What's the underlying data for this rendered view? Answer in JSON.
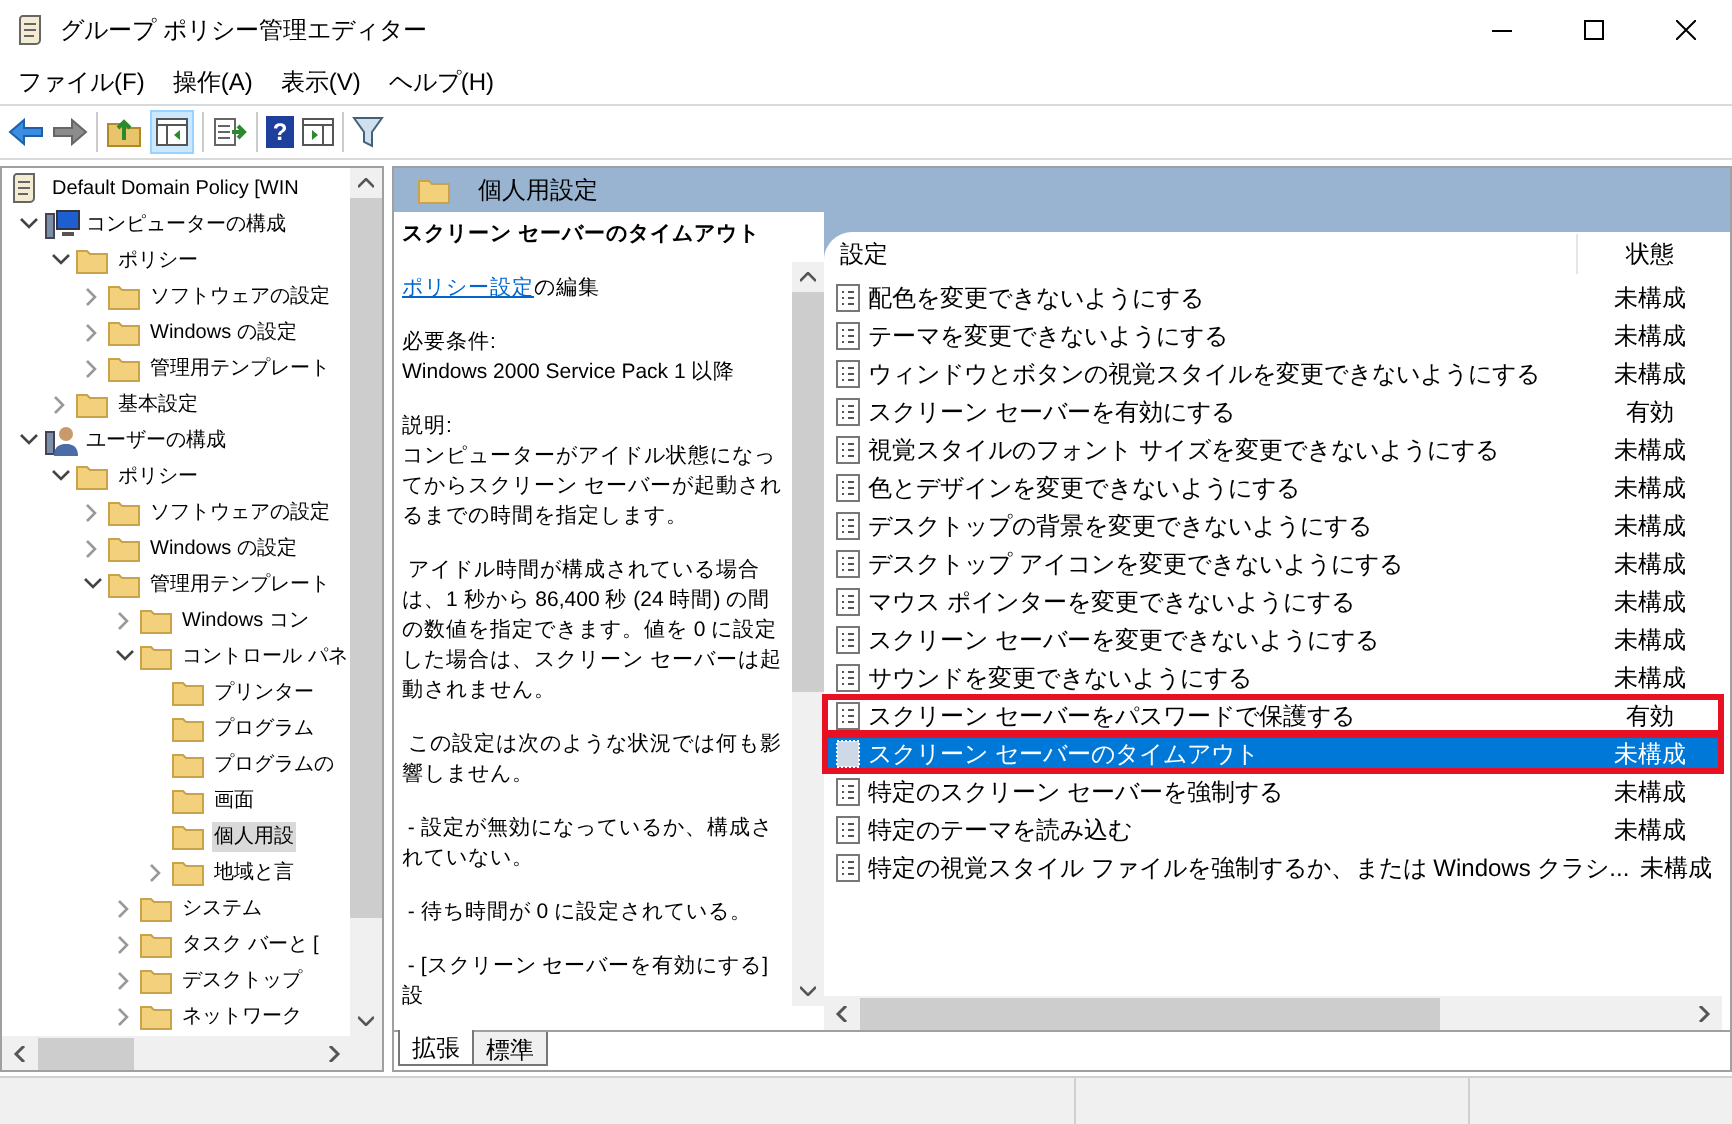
{
  "window": {
    "title": "グループ ポリシー管理エディター"
  },
  "menu": [
    "ファイル(F)",
    "操作(A)",
    "表示(V)",
    "ヘルプ(H)"
  ],
  "toolbar": {
    "console_tree_pressed": true,
    "help_glyph": "?"
  },
  "tree": [
    {
      "label": "Default Domain Policy [WIN",
      "kind": "policy",
      "selected": false,
      "children": [
        {
          "label": "コンピューターの構成",
          "kind": "computer",
          "expanded": true,
          "selected": false,
          "children": [
            {
              "label": "ポリシー",
              "kind": "folder",
              "expanded": true,
              "selected": false,
              "children": [
                {
                  "label": "ソフトウェアの設定",
                  "kind": "folder",
                  "expanded": false,
                  "selected": false
                },
                {
                  "label": "Windows の設定",
                  "kind": "folder",
                  "expanded": false,
                  "selected": false
                },
                {
                  "label": "管理用テンプレート",
                  "kind": "folder",
                  "expanded": false,
                  "selected": false
                }
              ]
            },
            {
              "label": "基本設定",
              "kind": "folder",
              "expanded": false,
              "selected": false
            }
          ]
        },
        {
          "label": "ユーザーの構成",
          "kind": "user",
          "expanded": true,
          "selected": false,
          "children": [
            {
              "label": "ポリシー",
              "kind": "folder",
              "expanded": true,
              "selected": false,
              "children": [
                {
                  "label": "ソフトウェアの設定",
                  "kind": "folder",
                  "expanded": false,
                  "selected": false
                },
                {
                  "label": "Windows の設定",
                  "kind": "folder",
                  "expanded": false,
                  "selected": false
                },
                {
                  "label": "管理用テンプレート",
                  "kind": "folder",
                  "expanded": true,
                  "selected": false,
                  "children": [
                    {
                      "label": "Windows コン",
                      "kind": "folder",
                      "expanded": false,
                      "selected": false
                    },
                    {
                      "label": "コントロール パネ",
                      "kind": "folder",
                      "expanded": true,
                      "selected": false,
                      "children": [
                        {
                          "label": "プリンター",
                          "kind": "folder",
                          "selected": false
                        },
                        {
                          "label": "プログラム",
                          "kind": "folder",
                          "selected": false
                        },
                        {
                          "label": "プログラムの",
                          "kind": "folder",
                          "selected": false
                        },
                        {
                          "label": "画面",
                          "kind": "folder",
                          "selected": false
                        },
                        {
                          "label": "個人用設",
                          "kind": "folder",
                          "selected": true
                        },
                        {
                          "label": "地域と言",
                          "kind": "folder",
                          "expanded": false,
                          "selected": false
                        }
                      ]
                    },
                    {
                      "label": "システム",
                      "kind": "folder",
                      "expanded": false,
                      "selected": false
                    },
                    {
                      "label": "タスク バーと [",
                      "kind": "folder",
                      "expanded": false,
                      "selected": false
                    },
                    {
                      "label": "デスクトップ",
                      "kind": "folder",
                      "expanded": false,
                      "selected": false
                    },
                    {
                      "label": "ネットワーク",
                      "kind": "folder",
                      "expanded": false,
                      "selected": false
                    }
                  ]
                }
              ]
            }
          ]
        }
      ]
    }
  ],
  "pane_title": "個人用設定",
  "description": {
    "title": "スクリーン セーバーのタイムアウト",
    "edit_link": "ポリシー設定",
    "edit_suffix": "の編集",
    "paragraphs": [
      "必要条件:\nWindows 2000 Service Pack 1 以降",
      "説明:\nコンピューターがアイドル状態になってからスクリーン セーバーが起動されるまでの時間を指定します。",
      " アイドル時間が構成されている場合は、1 秒から 86,400 秒 (24 時間) の間の数値を指定できます。値を 0 に設定した場合は、スクリーン セーバーは起動されません。",
      " この設定は次のような状況では何も影響しません。",
      " - 設定が無効になっているか、構成されていない。",
      " - 待ち時間が 0 に設定されている。",
      " - [スクリーン セーバーを有効にする] 設"
    ]
  },
  "columns": [
    "設定",
    "状態"
  ],
  "rows": [
    {
      "name": "配色を変更できないようにする",
      "state": "未構成",
      "selected": false,
      "annotated": false
    },
    {
      "name": "テーマを変更できないようにする",
      "state": "未構成",
      "selected": false,
      "annotated": false
    },
    {
      "name": "ウィンドウとボタンの視覚スタイルを変更できないようにする",
      "state": "未構成",
      "selected": false,
      "annotated": false
    },
    {
      "name": "スクリーン セーバーを有効にする",
      "state": "有効",
      "selected": false,
      "annotated": false
    },
    {
      "name": "視覚スタイルのフォント サイズを変更できないようにする",
      "state": "未構成",
      "selected": false,
      "annotated": false
    },
    {
      "name": "色とデザインを変更できないようにする",
      "state": "未構成",
      "selected": false,
      "annotated": false
    },
    {
      "name": "デスクトップの背景を変更できないようにする",
      "state": "未構成",
      "selected": false,
      "annotated": false
    },
    {
      "name": "デスクトップ アイコンを変更できないようにする",
      "state": "未構成",
      "selected": false,
      "annotated": false
    },
    {
      "name": "マウス ポインターを変更できないようにする",
      "state": "未構成",
      "selected": false,
      "annotated": false
    },
    {
      "name": "スクリーン セーバーを変更できないようにする",
      "state": "未構成",
      "selected": false,
      "annotated": false
    },
    {
      "name": "サウンドを変更できないようにする",
      "state": "未構成",
      "selected": false,
      "annotated": false
    },
    {
      "name": "スクリーン セーバーをパスワードで保護する",
      "state": "有効",
      "selected": false,
      "annotated": true
    },
    {
      "name": "スクリーン セーバーのタイムアウト",
      "state": "未構成",
      "selected": true,
      "annotated": true
    },
    {
      "name": "特定のスクリーン セーバーを強制する",
      "state": "未構成",
      "selected": false,
      "annotated": false
    },
    {
      "name": "特定のテーマを読み込む",
      "state": "未構成",
      "selected": false,
      "annotated": false
    },
    {
      "name": "特定の視覚スタイル ファイルを強制するか、または Windows クラシ...",
      "state": "未構成",
      "selected": false,
      "annotated": false
    }
  ],
  "bottom_tabs": [
    {
      "label": "拡張",
      "selected": true
    },
    {
      "label": "標準",
      "selected": false
    }
  ]
}
